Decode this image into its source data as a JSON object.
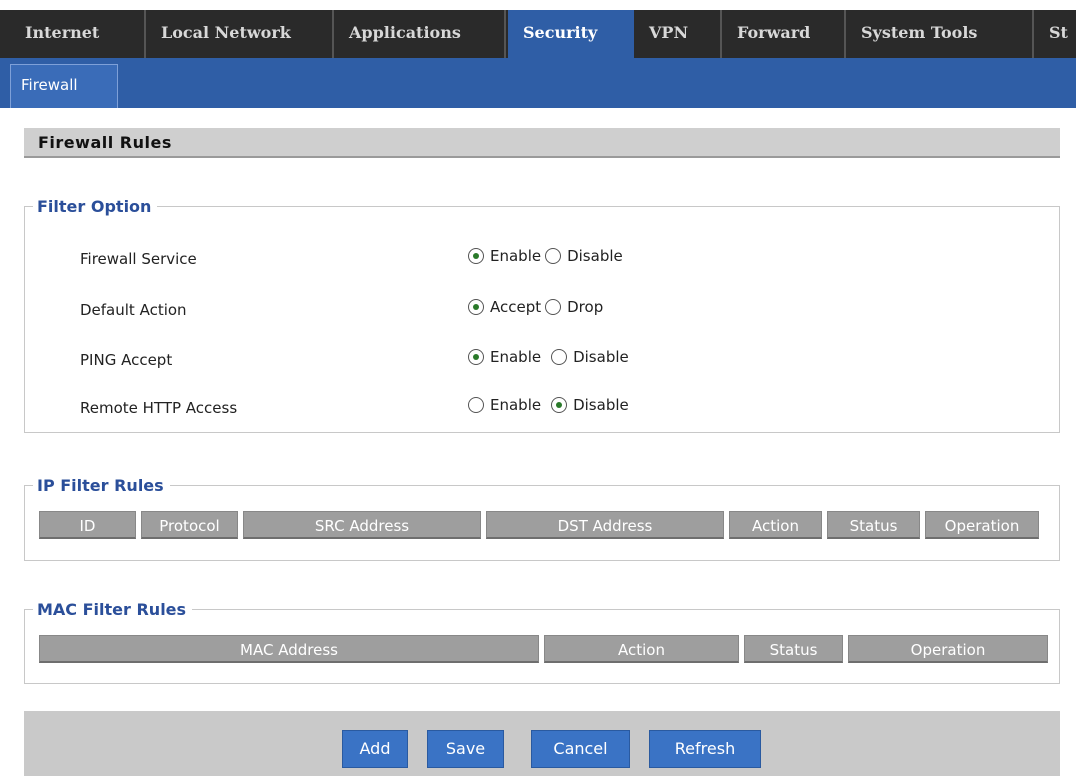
{
  "nav": {
    "tabs": [
      {
        "label": "Internet"
      },
      {
        "label": "Local Network"
      },
      {
        "label": "Applications"
      },
      {
        "label": "Security"
      },
      {
        "label": "VPN"
      },
      {
        "label": "Forward"
      },
      {
        "label": "System Tools"
      },
      {
        "label": "St"
      }
    ],
    "active_tab": "Security",
    "subtabs": [
      {
        "label": "Firewall"
      }
    ]
  },
  "page": {
    "title": "Firewall Rules"
  },
  "filter_option": {
    "legend": "Filter Option",
    "rows": [
      {
        "label": "Firewall Service",
        "options": [
          "Enable",
          "Disable"
        ],
        "selected": "Enable"
      },
      {
        "label": "Default Action",
        "options": [
          "Accept",
          "Drop"
        ],
        "selected": "Accept"
      },
      {
        "label": "PING Accept",
        "options": [
          "Enable",
          "Disable"
        ],
        "selected": "Enable"
      },
      {
        "label": "Remote HTTP Access",
        "options": [
          "Enable",
          "Disable"
        ],
        "selected": "Disable"
      }
    ]
  },
  "ip_filter": {
    "legend": "IP Filter Rules",
    "columns": [
      "ID",
      "Protocol",
      "SRC Address",
      "DST Address",
      "Action",
      "Status",
      "Operation"
    ]
  },
  "mac_filter": {
    "legend": "MAC Filter Rules",
    "columns": [
      "MAC Address",
      "Action",
      "Status",
      "Operation"
    ]
  },
  "buttons": {
    "add": "Add",
    "save": "Save",
    "cancel": "Cancel",
    "refresh": "Refresh"
  },
  "colors": {
    "accent": "#2f5ea6",
    "nav_bg": "#2a2a2a",
    "legend": "#2b4f9a",
    "table_header": "#9e9e9e",
    "button": "#3a73c5"
  }
}
